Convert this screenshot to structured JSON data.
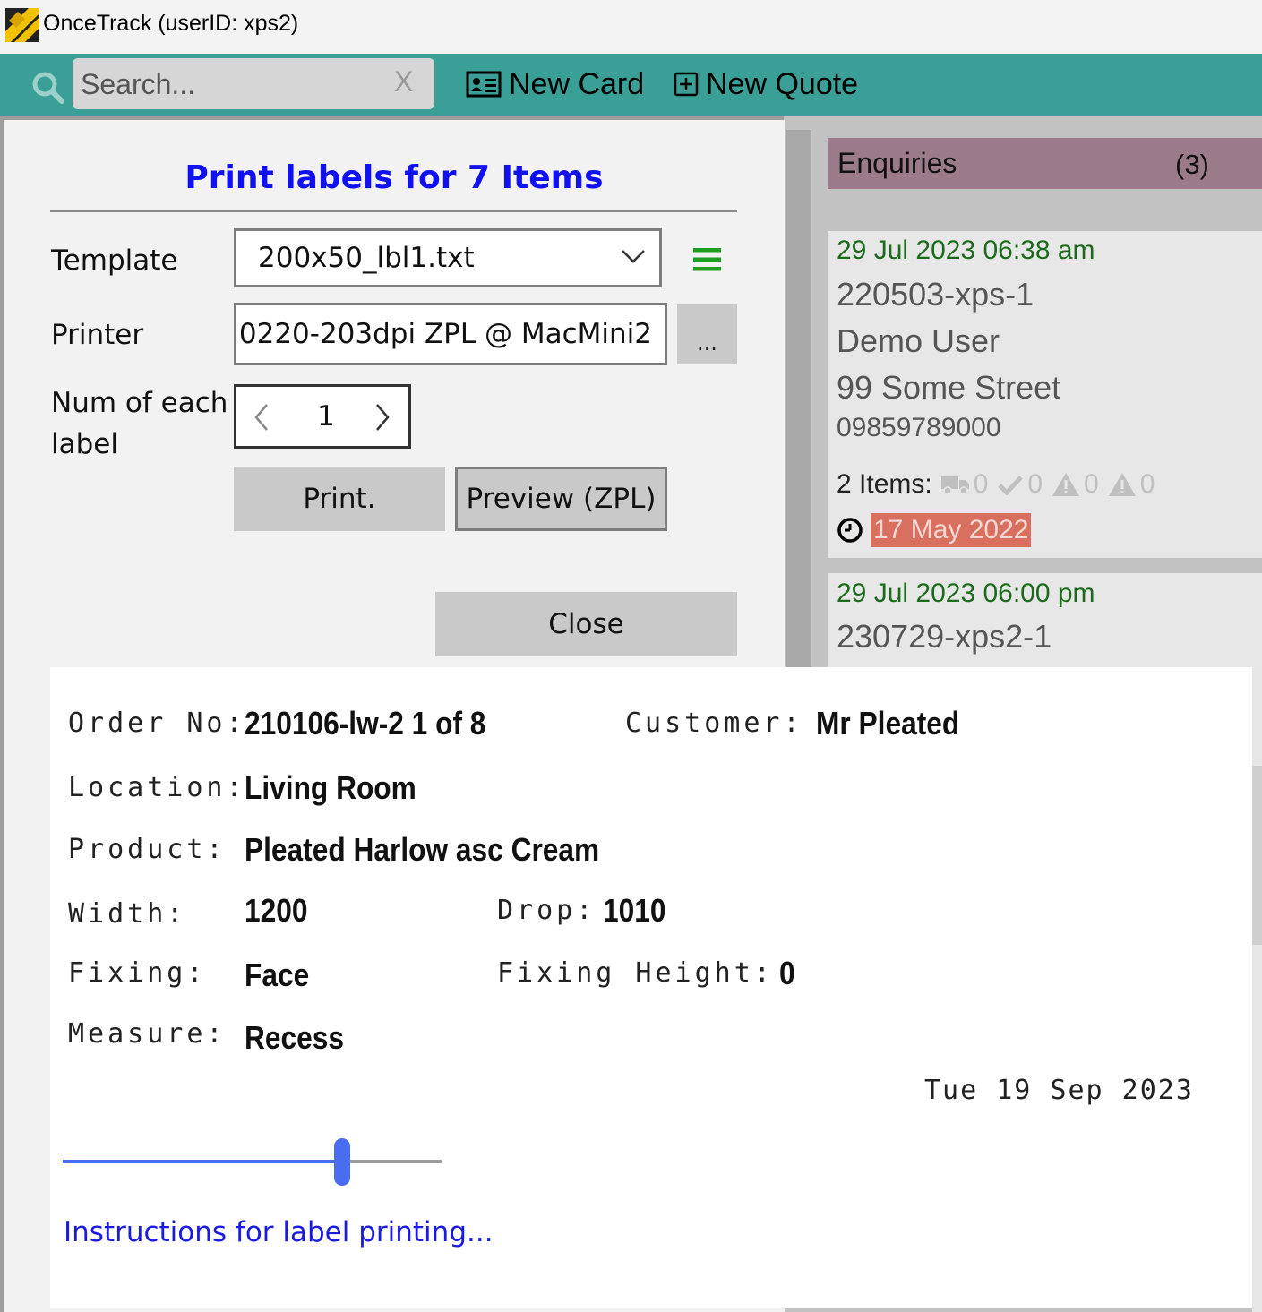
{
  "window": {
    "title": "OnceTrack  (userID: xps2)"
  },
  "toolbar": {
    "search_placeholder": "Search...",
    "search_clear": "X",
    "new_card_label": "New Card",
    "new_quote_label": "New Quote"
  },
  "enquiries": {
    "title": "Enquiries",
    "count": "(3)",
    "cards": [
      {
        "date": "29 Jul 2023 06:38 am",
        "id": "220503-xps-1",
        "name": "Demo User",
        "address": "99 Some Street",
        "phone": "09859789000",
        "items_label": "2 Items:",
        "stats": [
          "0",
          "0",
          "0",
          "0"
        ],
        "due_date": "17 May 2022"
      },
      {
        "date": "29 Jul 2023 06:00 pm",
        "id": "230729-xps2-1"
      }
    ]
  },
  "dialog": {
    "title": "Print labels for 7 Items",
    "template_label": "Template",
    "template_value": "200x50_lbl1.txt",
    "printer_label": "Printer",
    "printer_value": "0220-203dpi ZPL @ MacMini2",
    "printer_browse": "...",
    "num_label_line1": "Num of each",
    "num_label_line2": "label",
    "num_value": "1",
    "print_button": "Print.",
    "preview_button": "Preview (ZPL)",
    "close_button": "Close"
  },
  "label_preview": {
    "order_no_label": "Order No:",
    "order_no_value": "210106-lw-2 1 of 8",
    "customer_label": "Customer:",
    "customer_value": "Mr Pleated",
    "location_label": "Location:",
    "location_value": "Living Room",
    "product_label": "Product:",
    "product_value": "Pleated Harlow asc Cream",
    "width_label": "Width:",
    "width_value": "1200",
    "drop_label": "Drop:",
    "drop_value": "1010",
    "fixing_label": "Fixing:",
    "fixing_value": "Face",
    "fixing_height_label": "Fixing Height:",
    "fixing_height_value": "0",
    "measure_label": "Measure:",
    "measure_value": "Recess",
    "date": "Tue 19 Sep 2023",
    "zoom_level": 0.74,
    "instructions_link": "Instructions for label printing..."
  },
  "colors": {
    "toolbar": "#3a9f96",
    "dialog_title": "#1010f0",
    "enquiries_header": "#9b7a8c",
    "card_date": "#1c6b1c",
    "due_date_bg": "#d9705f",
    "slider": "#4a6cf0",
    "link": "#1a1ae0"
  },
  "icons": {
    "app_logo": "oncetrack-logo-icon",
    "search": "search-icon",
    "new_card": "id-card-icon",
    "new_quote": "plus-square-icon",
    "template_menu": "hamburger-menu-icon",
    "stats": [
      "truck-icon",
      "check-icon",
      "warning-icon",
      "warning-icon"
    ],
    "due": "clock-icon"
  }
}
